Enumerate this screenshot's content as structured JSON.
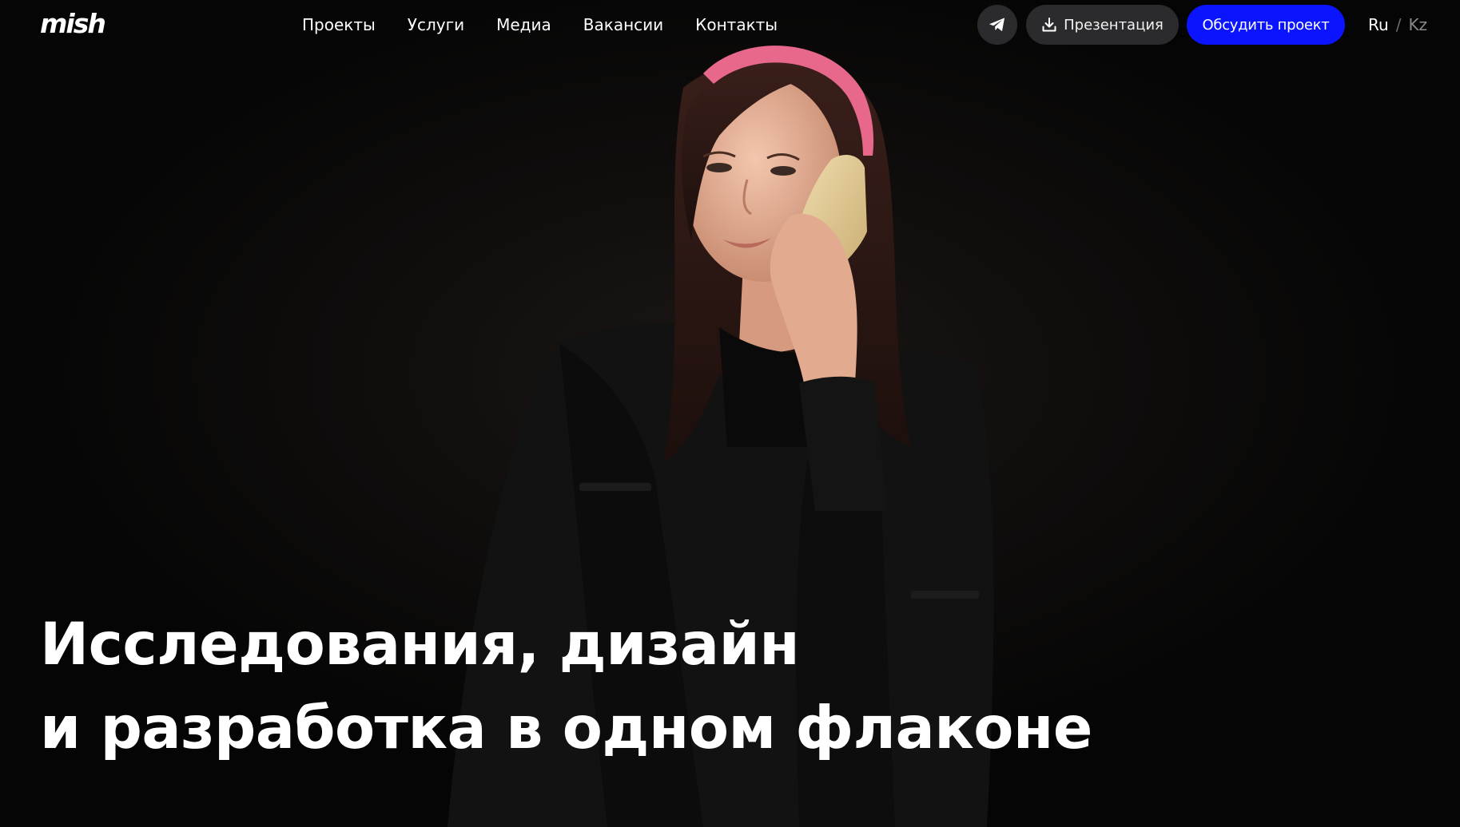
{
  "brand": {
    "logo_text": "mish"
  },
  "nav": {
    "items": [
      {
        "label": "Проекты"
      },
      {
        "label": "Услуги"
      },
      {
        "label": "Медиа"
      },
      {
        "label": "Вакансии"
      },
      {
        "label": "Контакты"
      }
    ]
  },
  "actions": {
    "telegram_icon": "telegram-icon",
    "presentation": {
      "label": "Презентация",
      "icon": "download-icon"
    },
    "cta": {
      "label": "Обсудить проект"
    }
  },
  "language": {
    "current": "Ru",
    "separator": "/",
    "other": "Kz"
  },
  "hero": {
    "headline_line1": "Исследования, дизайн",
    "headline_line2": "и разработка в одном флаконе",
    "image_description": "woman-on-phone"
  },
  "colors": {
    "background": "#050505",
    "accent": "#0a14ff",
    "pill": "#2b2b2d",
    "headband": "#e8688c"
  }
}
